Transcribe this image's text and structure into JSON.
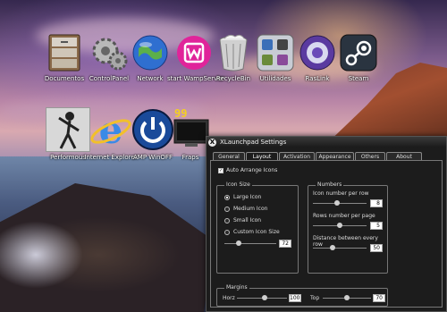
{
  "desktop": {
    "top_icons": [
      {
        "label": "Documentos",
        "icon": "drawer-icon"
      },
      {
        "label": "ControlPanel",
        "icon": "gears-icon"
      },
      {
        "label": "Network",
        "icon": "globe-icon"
      },
      {
        "label": "start WampServer",
        "icon": "wamp-icon"
      },
      {
        "label": "RecycleBin",
        "icon": "trash-icon"
      },
      {
        "label": "Utilidades",
        "icon": "utilities-icon"
      },
      {
        "label": "RasLink",
        "icon": "raslink-icon"
      },
      {
        "label": "Steam",
        "icon": "steam-icon"
      }
    ],
    "bottom_icons": [
      {
        "label": "Performous",
        "icon": "performous-icon"
      },
      {
        "label": "Internet Explorer",
        "icon": "ie-icon"
      },
      {
        "label": "AMP WinOFF",
        "icon": "power-icon"
      },
      {
        "label": "Fraps",
        "icon": "fraps-icon",
        "badge": "99"
      }
    ]
  },
  "window": {
    "title": "XLaunchpad Settings",
    "close_glyph": "X",
    "tabs": [
      "General",
      "Layout",
      "Activation",
      "Appearance",
      "Others",
      "About"
    ],
    "active_tab": "Layout",
    "auto_arrange": {
      "label": "Auto Arrange Icons",
      "checked": true,
      "check_glyph": "✓"
    },
    "icon_size": {
      "legend": "Icon Size",
      "options": [
        "Large Icon",
        "Medium Icon",
        "Small Icon",
        "Custom Icon Size"
      ],
      "selected": "Large Icon",
      "custom_value": "72",
      "custom_level": 0.25
    },
    "numbers": {
      "legend": "Numbers",
      "per_row_label": "Icon number per row",
      "per_row_value": "8",
      "per_row_level": 0.45,
      "per_page_label": "Rows number per page",
      "per_page_value": "5",
      "per_page_level": 0.5,
      "distance_label": "Distance between every row",
      "distance_value": "50",
      "distance_level": 0.35
    },
    "margins": {
      "legend": "Margins",
      "horz_label": "Horz",
      "horz_value": "100",
      "horz_level": 0.55,
      "top_label": "Top",
      "top_value": "70",
      "top_level": 0.5
    }
  }
}
